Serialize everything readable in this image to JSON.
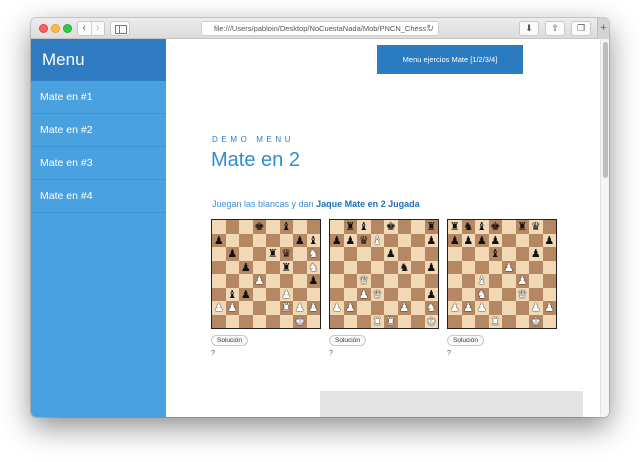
{
  "browser": {
    "url": "file:///Users/pabloin/Desktop/NoCuestaNada/Mob/PNCN_Chess..."
  },
  "sidebar": {
    "title": "Menu",
    "items": [
      {
        "label": "Mate en #1"
      },
      {
        "label": "Mate en #2"
      },
      {
        "label": "Mate en #3"
      },
      {
        "label": "Mate en #4"
      }
    ]
  },
  "main": {
    "top_button": "Menu ejercios Mate [1/2/3/4]",
    "eyebrow": "DEMO MENU",
    "title": "Mate en 2",
    "lead_prefix": "Juegan las blancas y dan ",
    "lead_bold": "Jaque Mate en 2 Jugada",
    "solution_label": "Solución",
    "answer_placeholder": "?"
  },
  "colors": {
    "sidebar_bg": "#4aa1e0",
    "sidebar_header_bg": "#2e7bc2",
    "accent": "#2b7bc0",
    "board_light": "#f1d9b5",
    "board_dark": "#b58863"
  },
  "boards": [
    {
      "rows": [
        "...k.b..",
        "p.....pb",
        ".p..rq.N",
        "..p..r.N",
        "...P...p",
        ".bp..P..",
        "PP...RPP",
        "......K."
      ]
    },
    {
      "rows": [
        ".rb.k..r",
        "ppqB...p",
        "....p...",
        ".....n.p",
        "..Q.....",
        "..PQ...p",
        "PP...P.N",
        "...RR..K"
      ]
    },
    {
      "rows": [
        "rnbk.rq.",
        "pppp...p",
        "...b..p.",
        "....P...",
        "..B..P..",
        "..N..Q..",
        "PPP...PP",
        "...R..K."
      ]
    }
  ]
}
